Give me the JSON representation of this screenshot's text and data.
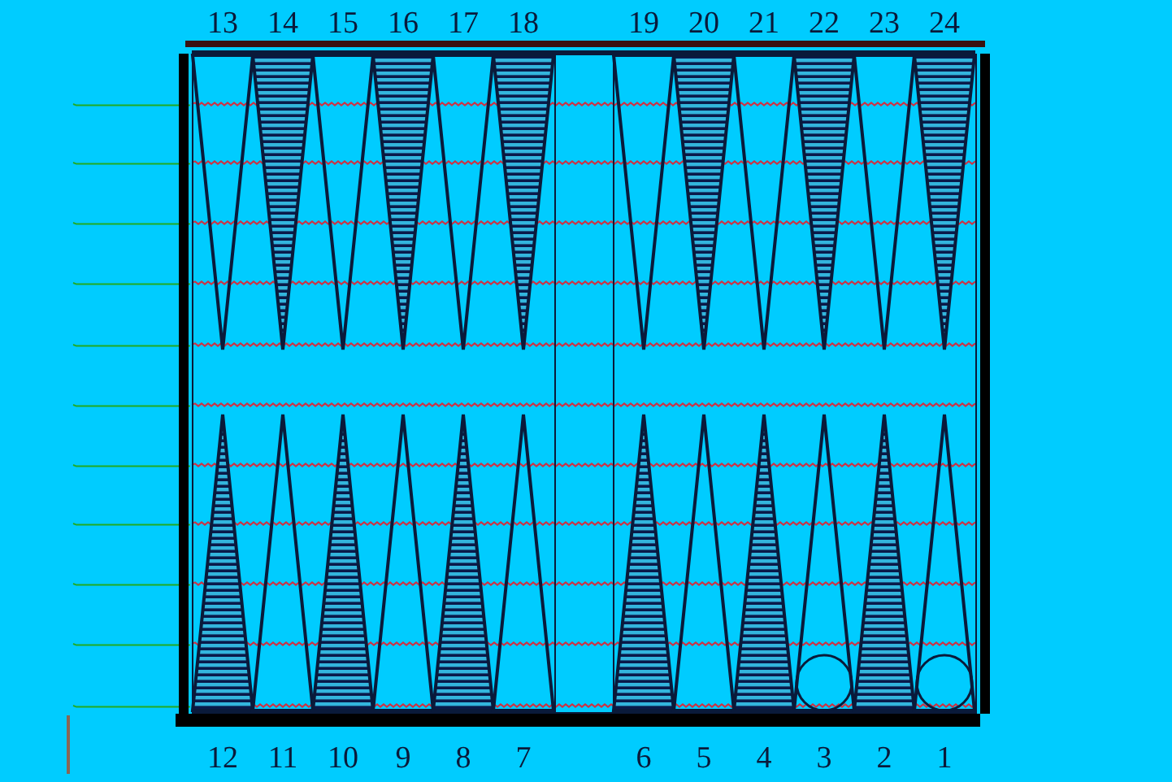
{
  "top_points": [
    {
      "label": "13",
      "kind": "plain",
      "checker": false
    },
    {
      "label": "14",
      "kind": "hatched",
      "checker": false
    },
    {
      "label": "15",
      "kind": "plain",
      "checker": false
    },
    {
      "label": "16",
      "kind": "hatched",
      "checker": false
    },
    {
      "label": "17",
      "kind": "plain",
      "checker": false
    },
    {
      "label": "18",
      "kind": "hatched",
      "checker": false
    },
    {
      "label": "19",
      "kind": "plain",
      "checker": false
    },
    {
      "label": "20",
      "kind": "hatched",
      "checker": false
    },
    {
      "label": "21",
      "kind": "plain",
      "checker": false
    },
    {
      "label": "22",
      "kind": "hatched",
      "checker": false
    },
    {
      "label": "23",
      "kind": "plain",
      "checker": false
    },
    {
      "label": "24",
      "kind": "hatched",
      "checker": false
    }
  ],
  "bottom_points": [
    {
      "label": "12",
      "kind": "hatched",
      "checker": false
    },
    {
      "label": "11",
      "kind": "plain",
      "checker": false
    },
    {
      "label": "10",
      "kind": "hatched",
      "checker": false
    },
    {
      "label": "9",
      "kind": "plain",
      "checker": false
    },
    {
      "label": "8",
      "kind": "hatched",
      "checker": false
    },
    {
      "label": "7",
      "kind": "plain",
      "checker": false
    },
    {
      "label": "6",
      "kind": "hatched",
      "checker": false
    },
    {
      "label": "5",
      "kind": "plain",
      "checker": false
    },
    {
      "label": "4",
      "kind": "hatched",
      "checker": false
    },
    {
      "label": "3",
      "kind": "plain",
      "checker": true
    },
    {
      "label": "2",
      "kind": "hatched",
      "checker": false
    },
    {
      "label": "1",
      "kind": "plain",
      "checker": true
    }
  ]
}
